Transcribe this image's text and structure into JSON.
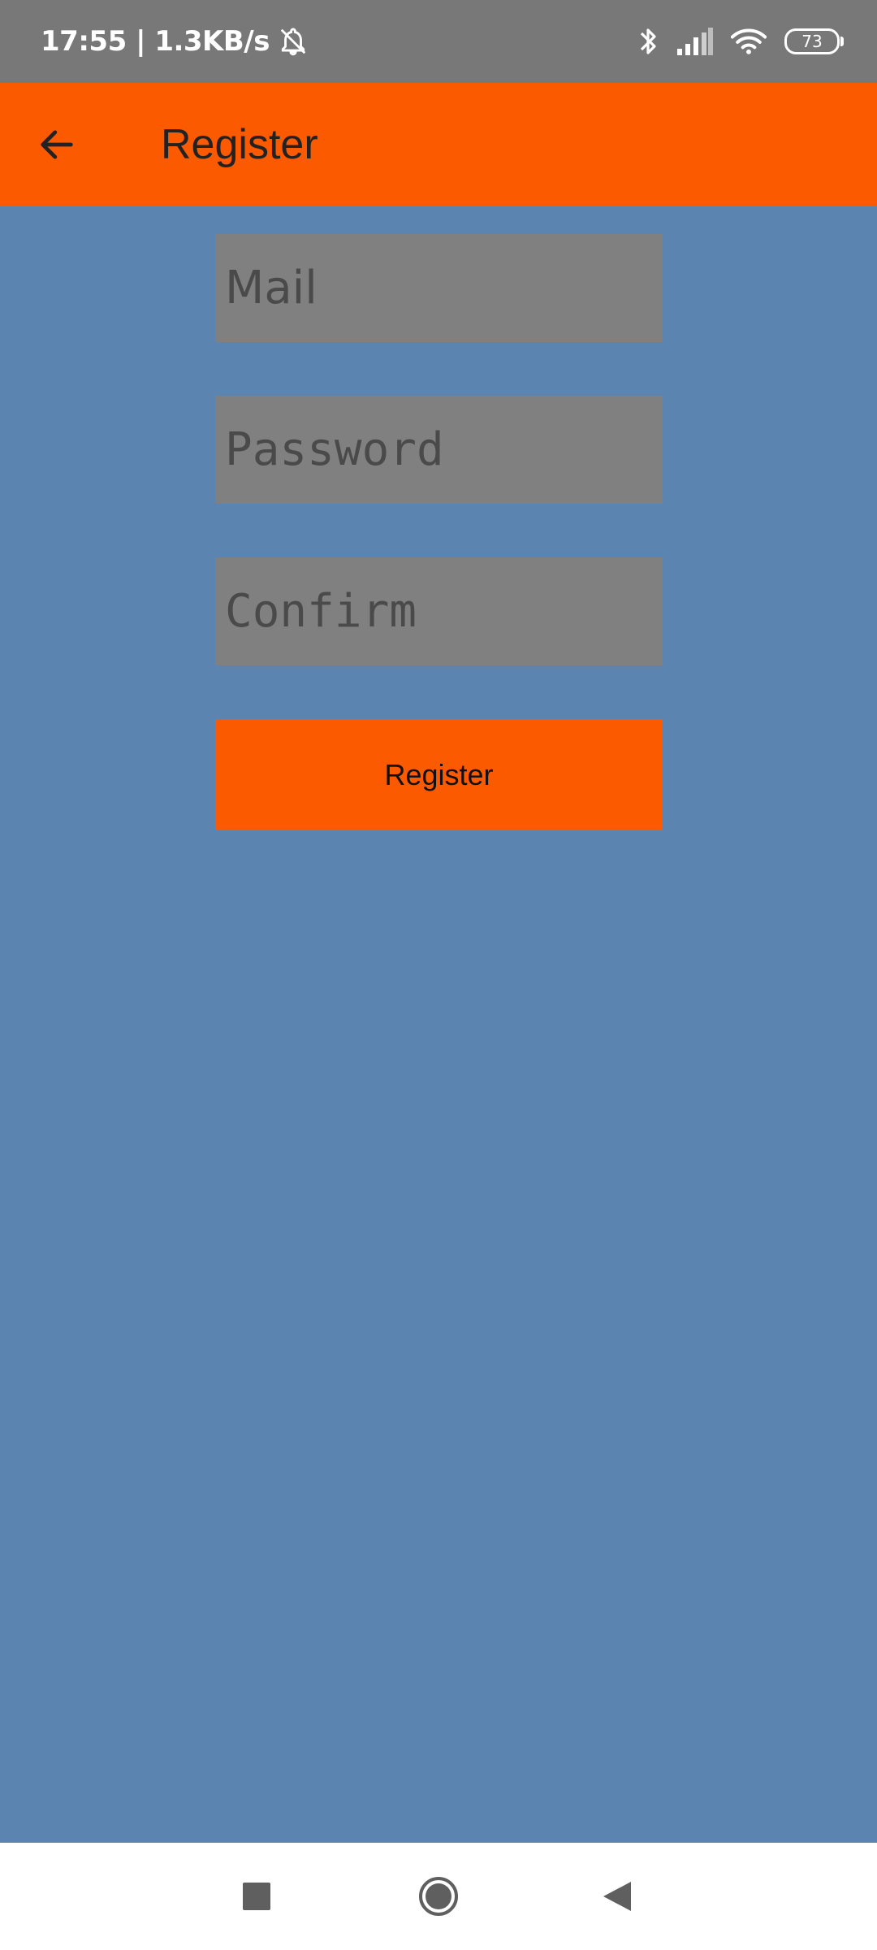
{
  "status_bar": {
    "time_and_speed": "17:55 | 1.3KB/s",
    "battery_level": "73",
    "icons": [
      "bell-off-icon",
      "bluetooth-icon",
      "signal-icon",
      "wifi-icon",
      "battery-icon"
    ]
  },
  "app_bar": {
    "title": "Register",
    "back_icon": "arrow-left-icon",
    "color": "#fc5a00"
  },
  "form": {
    "mail_placeholder": "Mail",
    "password_placeholder": "Password",
    "confirm_placeholder": "Confirm",
    "submit_label": "Register"
  },
  "nav_bar": {
    "icons": [
      "recents-square-icon",
      "home-circle-icon",
      "back-triangle-icon"
    ]
  },
  "colors": {
    "background": "#5b84b1",
    "accent": "#fc5a00",
    "field": "#808080",
    "status_bar": "#787878"
  }
}
